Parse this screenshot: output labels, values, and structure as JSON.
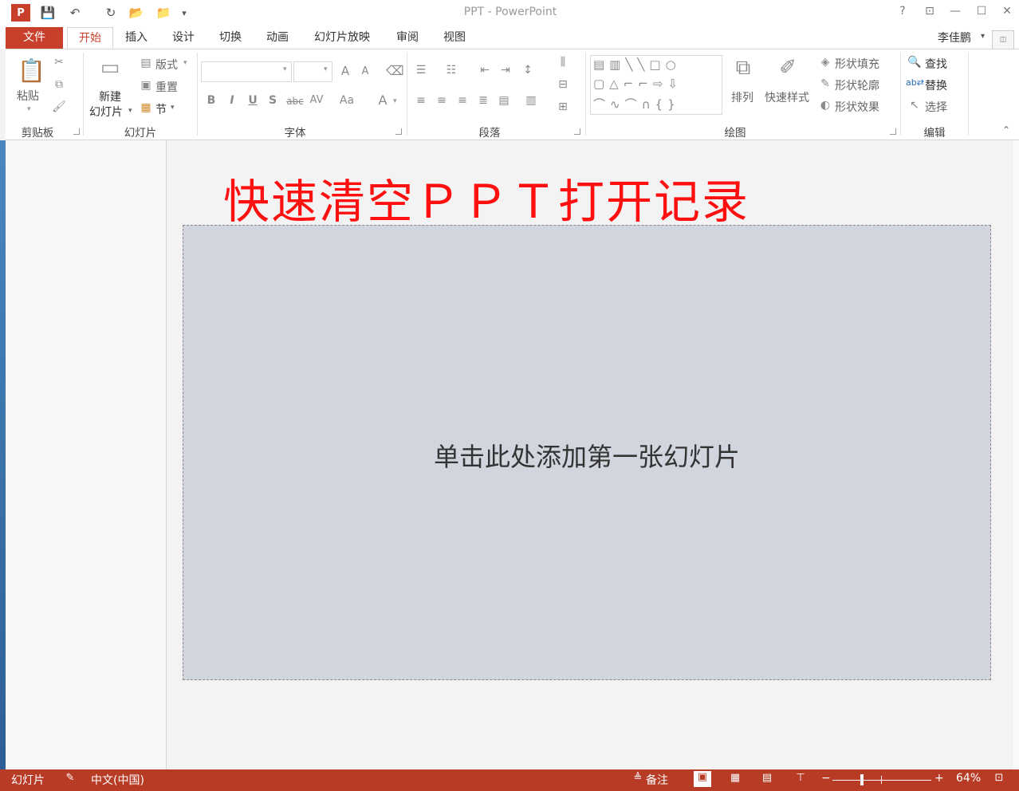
{
  "window": {
    "title": "PPT - PowerPoint",
    "help": "?",
    "ribbon_display": "⊡",
    "minimize": "—",
    "maximize": "☐",
    "close": "✕"
  },
  "qat": {
    "app_icon": "P",
    "save": "💾",
    "undo": "↶",
    "redo": "↻",
    "open": "📂",
    "customize": "▾"
  },
  "tabs": {
    "file": "文件",
    "items": [
      "开始",
      "插入",
      "设计",
      "切换",
      "动画",
      "幻灯片放映",
      "审阅",
      "视图"
    ],
    "active_index": 0
  },
  "user": {
    "name": "李佳鹏"
  },
  "ribbon": {
    "clipboard": {
      "group": "剪贴板",
      "paste": "粘贴"
    },
    "slides": {
      "group": "幻灯片",
      "new_slide_line1": "新建",
      "new_slide_line2": "幻灯片",
      "layout": "版式",
      "reset": "重置",
      "section": "节"
    },
    "font": {
      "group": "字体",
      "bold": "B",
      "italic": "I",
      "underline": "U",
      "shadow": "S",
      "strike": "abc",
      "spacing": "AV",
      "case": "Aa",
      "color": "A",
      "grow": "A",
      "shrink": "A"
    },
    "paragraph": {
      "group": "段落"
    },
    "drawing": {
      "group": "绘图",
      "arrange": "排列",
      "quick_styles": "快速样式",
      "shape_fill": "形状填充",
      "shape_outline": "形状轮廓",
      "shape_effects": "形状效果"
    },
    "editing": {
      "group": "编辑",
      "find": "查找",
      "replace": "替换",
      "select": "选择"
    }
  },
  "overlay_caption": "快速清空ＰＰＴ打开记录",
  "slide": {
    "placeholder": "单击此处添加第一张幻灯片"
  },
  "status": {
    "slide_label": "幻灯片",
    "language": "中文(中国)",
    "notes": "备注",
    "zoom": "64%",
    "zoom_level": 0.64
  },
  "colors": {
    "accent": "#c8402b",
    "status_bar": "#b83b26",
    "overlay_text": "#ff1010",
    "slide_bg": "#d0d5de"
  }
}
